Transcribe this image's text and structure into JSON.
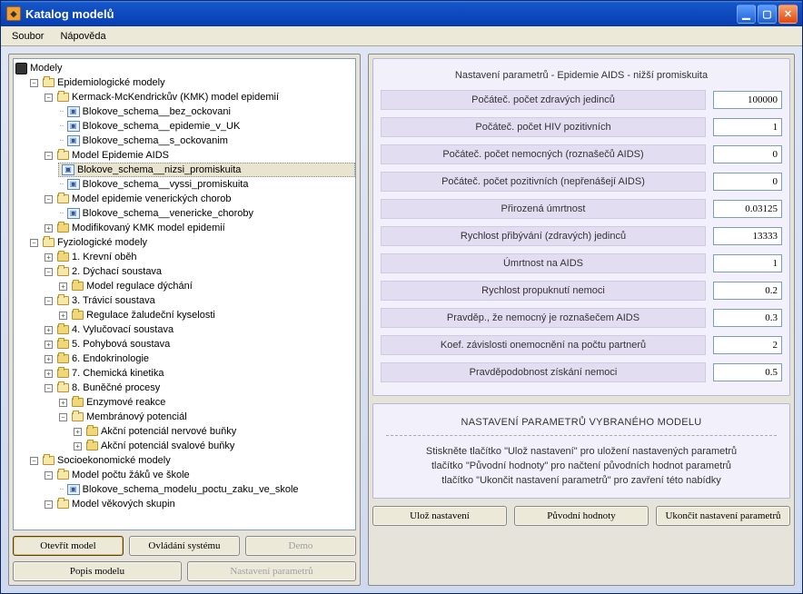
{
  "window": {
    "title": "Katalog modelů"
  },
  "menu": {
    "file": "Soubor",
    "help": "Nápověda"
  },
  "tree": {
    "root": "Modely",
    "epi": "Epidemiologické modely",
    "kmk": "Kermack-McKendrickův (KMK) model epidemií",
    "kmk1": "Blokove_schema__bez_ockovani",
    "kmk2": "Blokove_schema__epidemie_v_UK",
    "kmk3": "Blokove_schema__s_ockovanim",
    "aids": "Model Epidemie AIDS",
    "aids1": "Blokove_schema__nizsi_promiskuita",
    "aids2": "Blokove_schema__vyssi_promiskuita",
    "ven": "Model epidemie venerických chorob",
    "ven1": "Blokove_schema__venericke_choroby",
    "modkmk": "Modifikovaný KMK model epidemií",
    "fyz": "Fyziologické modely",
    "f1": "1. Krevní oběh",
    "f2": "2. Dýchací soustava",
    "f2a": "Model regulace dýchání",
    "f3": "3. Trávicí soustava",
    "f3a": "Regulace žaludeční kyselosti",
    "f4": "4. Vylučovací soustava",
    "f5": "5. Pohybová soustava",
    "f6": "6. Endokrinologie",
    "f7": "7. Chemická kinetika",
    "f8": "8. Buněčné procesy",
    "f8a": "Enzymové reakce",
    "f8b": "Membránový potenciál",
    "f8b1": "Akční potenciál nervové buňky",
    "f8b2": "Akční potenciál svalové buňky",
    "soc": "Socioekonomické modely",
    "soc1": "Model počtu žáků ve škole",
    "soc1a": "Blokove_schema_modelu_poctu_zaku_ve_skole",
    "soc2": "Model věkových skupin"
  },
  "leftButtons": {
    "open": "Otevřít model",
    "control": "Ovládání systému",
    "demo": "Demo",
    "desc": "Popis modelu",
    "params": "Nastavení parametrů"
  },
  "params": {
    "title": "Nastavení parametrů - Epidemie AIDS - nižší promiskuita",
    "rows": [
      {
        "label": "Počáteč. počet zdravých jedinců",
        "value": "100000"
      },
      {
        "label": "Počáteč. počet HIV pozitivních",
        "value": "1"
      },
      {
        "label": "Počáteč. počet nemocných (roznašečů AIDS)",
        "value": "0"
      },
      {
        "label": "Počáteč. počet pozitivních (nepřenášejí AIDS)",
        "value": "0"
      },
      {
        "label": "Přirozená úmrtnost",
        "value": "0.03125"
      },
      {
        "label": "Rychlost přibývání (zdravých) jedinců",
        "value": "13333"
      },
      {
        "label": "Úmrtnost na AIDS",
        "value": "1"
      },
      {
        "label": "Rychlost propuknutí nemoci",
        "value": "0.2"
      },
      {
        "label": "Pravděp., že nemocný je roznašečem AIDS",
        "value": "0.3"
      },
      {
        "label": "Koef. závislosti onemocnění na počtu partnerů",
        "value": "2"
      },
      {
        "label": "Pravděpodobnost získání nemoci",
        "value": "0.5"
      }
    ]
  },
  "info": {
    "heading": "NASTAVENÍ PARAMETRŮ VYBRANÉHO MODELU",
    "line1": "Stiskněte tlačítko \"Ulož nastavení\" pro uložení nastavených parametrů",
    "line2": "tlačítko \"Původní hodnoty\" pro načtení původních hodnot parametrů",
    "line3": "tlačítko \"Ukončit nastavení parametrů\" pro zavření této nabídky"
  },
  "rightButtons": {
    "save": "Ulož nastavení",
    "orig": "Původní hodnoty",
    "close": "Ukončit nastavení parametrů"
  }
}
